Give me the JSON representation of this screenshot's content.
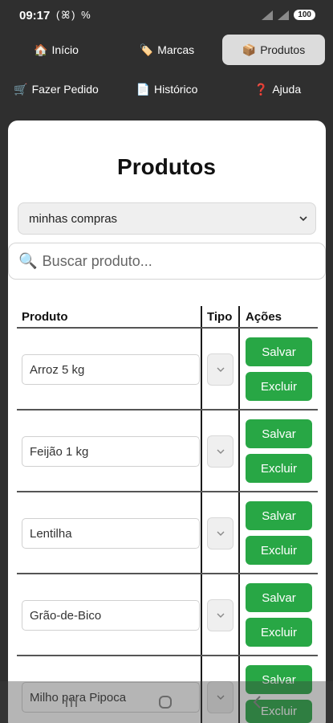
{
  "status": {
    "time": "09:17",
    "left_icons": "(ꕤ) %",
    "battery": "100"
  },
  "nav": {
    "items": [
      {
        "icon": "🏠",
        "label": "Início",
        "active": false
      },
      {
        "icon": "🏷️",
        "label": "Marcas",
        "active": false
      },
      {
        "icon": "📦",
        "label": "Produtos",
        "active": true
      },
      {
        "icon": "🛒",
        "label": "Fazer Pedido",
        "active": false
      },
      {
        "icon": "📄",
        "label": "Histórico",
        "active": false
      },
      {
        "icon": "❓",
        "label": "Ajuda",
        "active": false
      }
    ]
  },
  "page": {
    "title": "Produtos"
  },
  "list_select": {
    "value": "minhas compras"
  },
  "search": {
    "icon": "🔍",
    "placeholder": "Buscar produto..."
  },
  "table": {
    "headers": {
      "produto": "Produto",
      "tipo": "Tipo",
      "acoes": "Ações"
    },
    "rows": [
      {
        "name": "Arroz 5 kg"
      },
      {
        "name": "Feijão 1 kg"
      },
      {
        "name": "Lentilha"
      },
      {
        "name": "Grão-de-Bico"
      },
      {
        "name": "Milho para Pipoca"
      }
    ],
    "save_label": "Salvar",
    "delete_label": "Excluir"
  },
  "colors": {
    "accent_green": "#28a745",
    "dark_bg": "#2f2f2f"
  }
}
